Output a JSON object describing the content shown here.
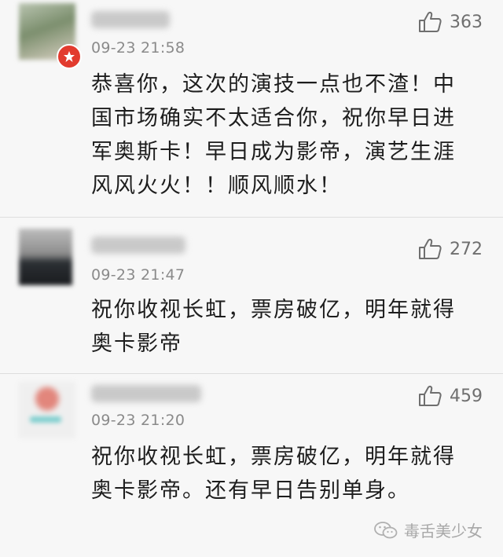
{
  "comments": [
    {
      "time": "09-23 21:58",
      "likes": "363",
      "text": "恭喜你，这次的演技一点也不渣！中国市场确实不太适合你，祝你早日进军奥斯卡！早日成为影帝，演艺生涯风风火火！！顺风顺水！"
    },
    {
      "time": "09-23 21:47",
      "likes": "272",
      "text": "祝你收视长虹，票房破亿，明年就得奥卡影帝"
    },
    {
      "time": "09-23 21:20",
      "likes": "459",
      "text": "祝你收视长虹，票房破亿，明年就得奥卡影帝。还有早日告别单身。"
    }
  ],
  "watermark": {
    "text": "毒舌美少女",
    "icon": "wechat-icon"
  },
  "colors": {
    "background": "#f7f7f7",
    "text": "#1d1d1d",
    "meta": "#8a8a8a",
    "badge": "#e23b2e"
  }
}
